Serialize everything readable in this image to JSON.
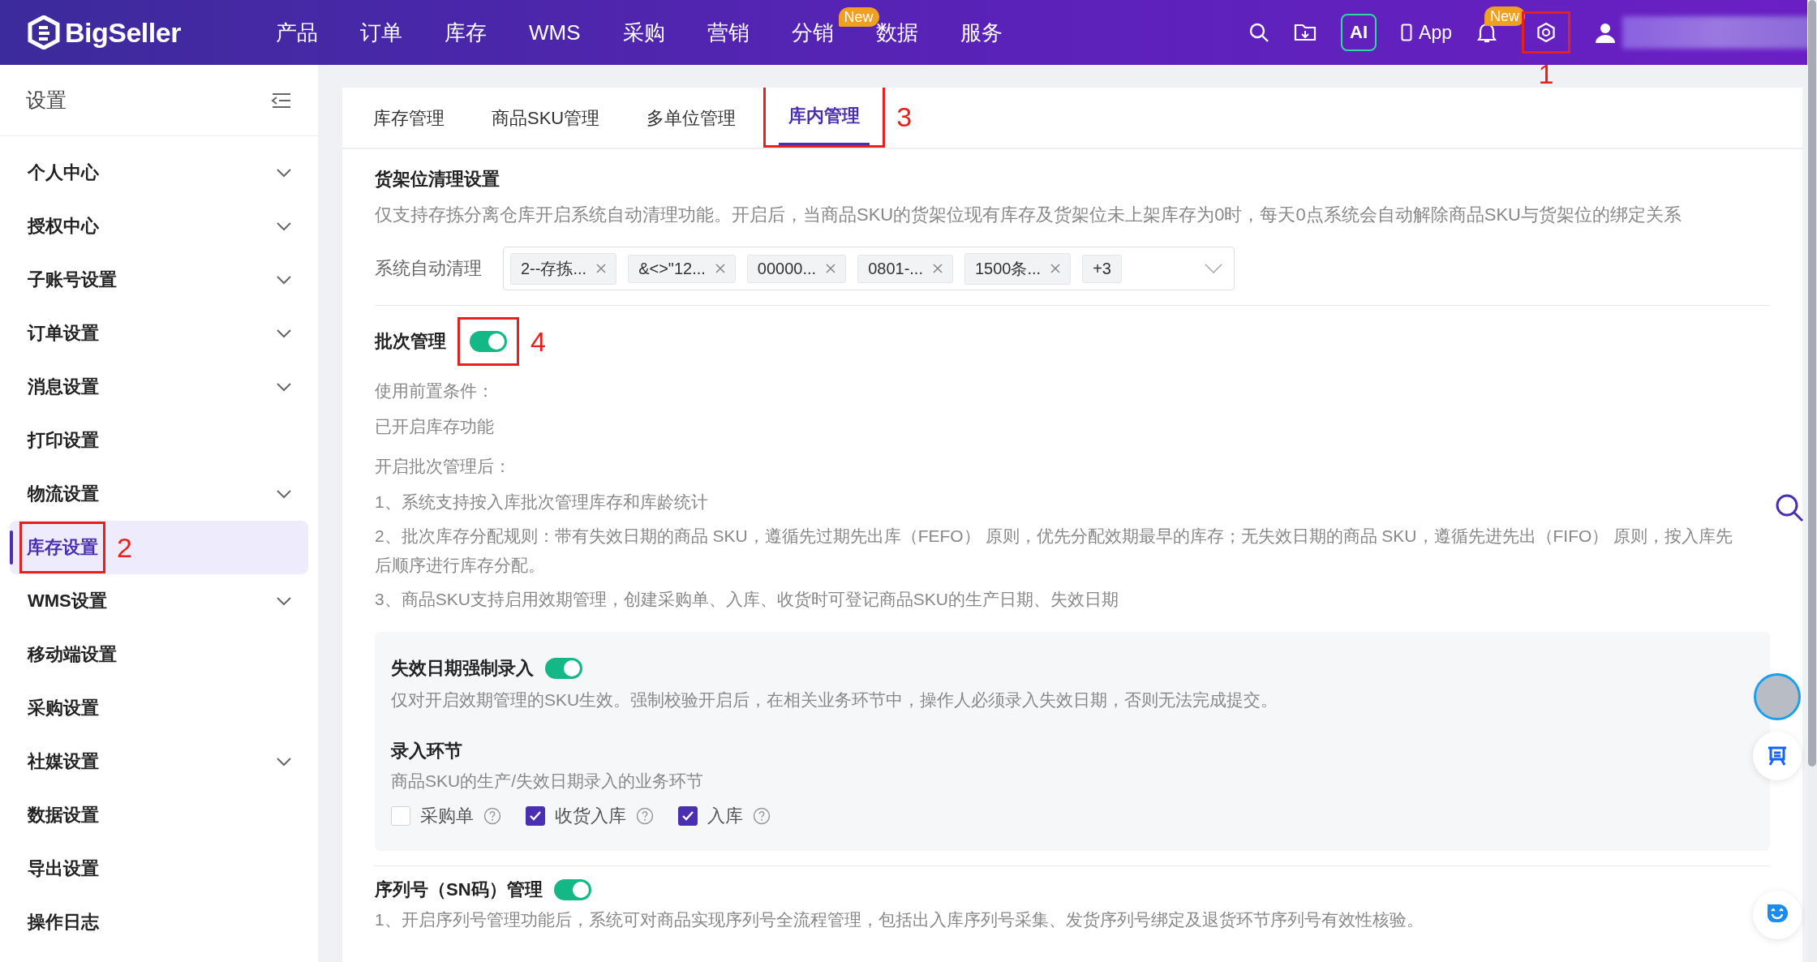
{
  "header": {
    "logo": "BigSeller",
    "nav": [
      {
        "label": "产品"
      },
      {
        "label": "订单"
      },
      {
        "label": "库存"
      },
      {
        "label": "WMS"
      },
      {
        "label": "采购"
      },
      {
        "label": "营销"
      },
      {
        "label": "分销",
        "badge": "New"
      },
      {
        "label": "数据"
      },
      {
        "label": "服务"
      }
    ],
    "tools": [
      {
        "kind": "search"
      },
      {
        "kind": "folder"
      },
      {
        "kind": "ai",
        "label": "AI"
      },
      {
        "kind": "app",
        "label": "App"
      },
      {
        "kind": "bell",
        "badge": "New"
      },
      {
        "kind": "gear",
        "annotation": "1"
      },
      {
        "kind": "user"
      }
    ]
  },
  "sidebar": {
    "title": "设置",
    "items": [
      {
        "label": "个人中心",
        "expandable": true,
        "selected": false
      },
      {
        "label": "授权中心",
        "expandable": true,
        "selected": false
      },
      {
        "label": "子账号设置",
        "expandable": true,
        "selected": false
      },
      {
        "label": "订单设置",
        "expandable": true,
        "selected": false
      },
      {
        "label": "消息设置",
        "expandable": true,
        "selected": false
      },
      {
        "label": "打印设置",
        "expandable": false,
        "selected": false
      },
      {
        "label": "物流设置",
        "expandable": true,
        "selected": false
      },
      {
        "label": "库存设置",
        "expandable": false,
        "selected": true,
        "annotation": "2"
      },
      {
        "label": "WMS设置",
        "expandable": true,
        "selected": false
      },
      {
        "label": "移动端设置",
        "expandable": false,
        "selected": false
      },
      {
        "label": "采购设置",
        "expandable": false,
        "selected": false
      },
      {
        "label": "社媒设置",
        "expandable": true,
        "selected": false
      },
      {
        "label": "数据设置",
        "expandable": false,
        "selected": false
      },
      {
        "label": "导出设置",
        "expandable": false,
        "selected": false
      },
      {
        "label": "操作日志",
        "expandable": false,
        "selected": false
      }
    ]
  },
  "tabs": [
    {
      "label": "库存管理",
      "selected": false
    },
    {
      "label": "商品SKU管理",
      "selected": false
    },
    {
      "label": "多单位管理",
      "selected": false
    },
    {
      "label": "库内管理",
      "selected": true,
      "annotation": "3"
    }
  ],
  "shelf_cleanup": {
    "title": "货架位清理设置",
    "description": "仅支持存拣分离仓库开启系统自动清理功能。开启后，当商品SKU的货架位现有库存及货架位未上架库存为0时，每天0点系统会自动解除商品SKU与货架位的绑定关系",
    "field": {
      "label": "系统自动清理",
      "tags": [
        "2--存拣...",
        "&<>\"12...",
        "00000...",
        "0801-...",
        "1500条..."
      ],
      "more": "+3"
    }
  },
  "batch": {
    "title": "批次管理",
    "on": true,
    "annotation": "4",
    "paragraphs": [
      [
        "使用前置条件：",
        "已开启库存功能"
      ],
      [
        "开启批次管理后：",
        "1、系统支持按入库批次管理库存和库龄统计",
        "2、批次库存分配规则：带有失效日期的商品 SKU，遵循先过期先出库（FEFO） 原则，优先分配效期最早的库存；无失效日期的商品 SKU，遵循先进先出（FIFO） 原则，按入库先后顺序进行库存分配。",
        "3、商品SKU支持启用效期管理，创建采购单、入库、收货时可登记商品SKU的生产日期、失效日期"
      ]
    ]
  },
  "expiry_panel": {
    "title": "失效日期强制录入",
    "on": true,
    "description": "仅对开启效期管理的SKU生效。强制校验开启后，在相关业务环节中，操作人必须录入失效日期，否则无法完成提交。",
    "sub_title": "录入环节",
    "sub_description": "商品SKU的生产/失效日期录入的业务环节",
    "options": [
      {
        "label": "采购单",
        "checked": false
      },
      {
        "label": "收货入库",
        "checked": true
      },
      {
        "label": "入库",
        "checked": true
      }
    ]
  },
  "serial": {
    "title": "序列号（SN码）管理",
    "on": true,
    "lines": [
      "1、开启序列号管理功能后，系统可对商品实现序列号全流程管理，包括出入库序列号采集、发货序列号绑定及退货环节序列号有效性核验。"
    ]
  }
}
